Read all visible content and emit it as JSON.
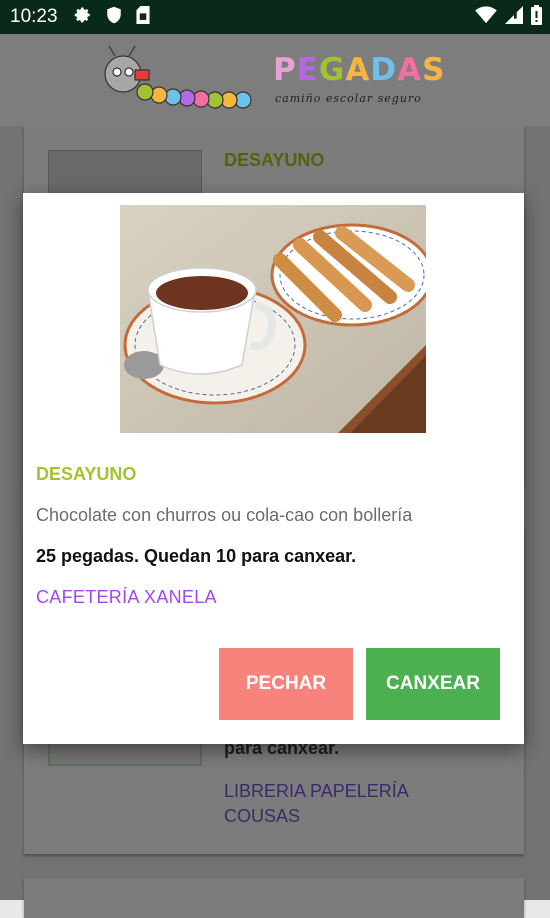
{
  "status_bar": {
    "time": "10:23",
    "icons": [
      "gear-icon",
      "shield-icon",
      "sim-card-icon",
      "wifi-icon",
      "signal-icon",
      "battery-icon"
    ]
  },
  "header": {
    "brand_letters": [
      "P",
      "E",
      "G",
      "A",
      "D",
      "A",
      "S"
    ],
    "brand_colors": [
      "#e6a1d6",
      "#b569e0",
      "#a1c232",
      "#f5b541",
      "#6fc0e8",
      "#f16ea3",
      "#f5b541"
    ],
    "tagline": "camiño escolar seguro"
  },
  "background_list": {
    "card1_title": "DESAYUNO",
    "card2_text_visible": "para canxear.",
    "card2_link_line1": "LIBRERIA PAPELERÍA",
    "card2_link_line2": "COUSAS"
  },
  "dialog": {
    "title": "DESAYUNO",
    "description": "Chocolate con churros ou cola-cao con bollería",
    "points_text": "25 pegadas. Quedan 10 para canxear.",
    "place": "CAFETERÍA XANELA",
    "close_label": "PECHAR",
    "redeem_label": "CANXEAR"
  },
  "colors": {
    "status_bar": "#0a2a19",
    "title_green": "#a2c32f",
    "place_purple": "#a146f5",
    "close_button": "#f8837c",
    "redeem_button": "#4caf50"
  }
}
